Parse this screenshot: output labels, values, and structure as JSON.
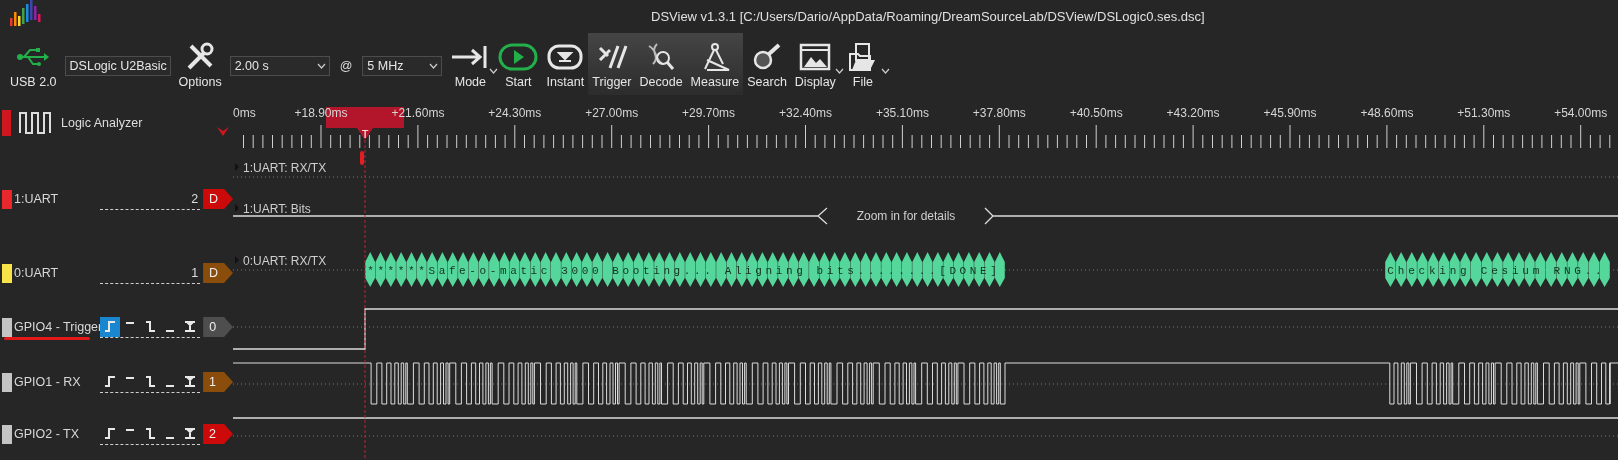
{
  "window": {
    "title": "DSView v1.3.1 [C:/Users/Dario/AppData/Roaming/DreamSourceLab/DSView/DSLogic0.ses.dsc]"
  },
  "toolbar": {
    "usb_label": "USB 2.0",
    "device": "DSLogic U2Basic",
    "options_label": "Options",
    "duration": "2.00 s",
    "at": "@",
    "rate": "5 MHz",
    "buttons": [
      {
        "kind": "mode",
        "label": "Mode",
        "menu": true,
        "highlighted": false
      },
      {
        "kind": "start",
        "label": "Start",
        "menu": false,
        "highlighted": false
      },
      {
        "kind": "instant",
        "label": "Instant",
        "menu": false,
        "highlighted": false
      },
      {
        "kind": "trigger",
        "label": "Trigger",
        "menu": false,
        "highlighted": true
      },
      {
        "kind": "decode",
        "label": "Decode",
        "menu": false,
        "highlighted": true
      },
      {
        "kind": "measure",
        "label": "Measure",
        "menu": false,
        "highlighted": true
      },
      {
        "kind": "search",
        "label": "Search",
        "menu": false,
        "highlighted": false
      },
      {
        "kind": "display",
        "label": "Display",
        "menu": true,
        "highlighted": false
      },
      {
        "kind": "file",
        "label": "File",
        "menu": true,
        "highlighted": false
      }
    ]
  },
  "panel": {
    "title": "Logic Analyzer"
  },
  "channels": [
    {
      "kind": "decoder",
      "name": "1:UART",
      "color": "#e8282c",
      "index": "2",
      "tag": {
        "text": "D",
        "color": "#cc0a0a"
      },
      "underlined": false
    },
    {
      "kind": "decoder",
      "name": "0:UART",
      "color": "#f8e448",
      "index": "1",
      "tag": {
        "text": "D",
        "color": "#8a4d0c"
      },
      "underlined": false
    },
    {
      "kind": "logic",
      "name": "GPIO4 - Trigger",
      "color": "#c4c4c4",
      "tag": {
        "text": "0",
        "color": "#4e4e4e"
      },
      "underlined": true,
      "triggers": [
        {
          "kind": "rise",
          "selected": true
        },
        {
          "kind": "high",
          "selected": false
        },
        {
          "kind": "fall",
          "selected": false
        },
        {
          "kind": "low",
          "selected": false
        },
        {
          "kind": "any",
          "selected": false
        }
      ]
    },
    {
      "kind": "logic",
      "name": "GPIO1 - RX",
      "color": "#c4c4c4",
      "tag": {
        "text": "1",
        "color": "#8a4d0c"
      },
      "underlined": false,
      "triggers": [
        {
          "kind": "rise",
          "selected": false
        },
        {
          "kind": "high",
          "selected": false
        },
        {
          "kind": "fall",
          "selected": false
        },
        {
          "kind": "low",
          "selected": false
        },
        {
          "kind": "any",
          "selected": false
        }
      ]
    },
    {
      "kind": "logic",
      "name": "GPIO2 - TX",
      "color": "#c4c4c4",
      "tag": {
        "text": "2",
        "color": "#cc0a0a"
      },
      "underlined": false,
      "triggers": [
        {
          "kind": "rise",
          "selected": false
        },
        {
          "kind": "high",
          "selected": false
        },
        {
          "kind": "fall",
          "selected": false
        },
        {
          "kind": "low",
          "selected": false
        },
        {
          "kind": "any",
          "selected": false
        }
      ]
    }
  ],
  "ruler": {
    "labels": [
      "0ms",
      "+18.90ms",
      "+21.60ms",
      "+24.30ms",
      "+27.00ms",
      "+29.70ms",
      "+32.40ms",
      "+35.10ms",
      "+37.80ms",
      "+40.50ms",
      "+43.20ms",
      "+45.90ms",
      "+48.60ms",
      "+51.30ms",
      "+54.00ms"
    ],
    "trigger_label": "T"
  },
  "decoder_rows": [
    {
      "kind": "annotations",
      "label": "1:UART: RX/TX"
    },
    {
      "kind": "bits",
      "label": "1:UART: Bits",
      "note": "Zoom in for details"
    },
    {
      "kind": "data",
      "label": "0:UART: RX/TX",
      "segments": [
        {
          "text": "******Safe-o-matic 3000 Booting... Aligning bits........[DONE]"
        },
        {
          "text": "Checking Cesium RNG.."
        }
      ]
    }
  ]
}
